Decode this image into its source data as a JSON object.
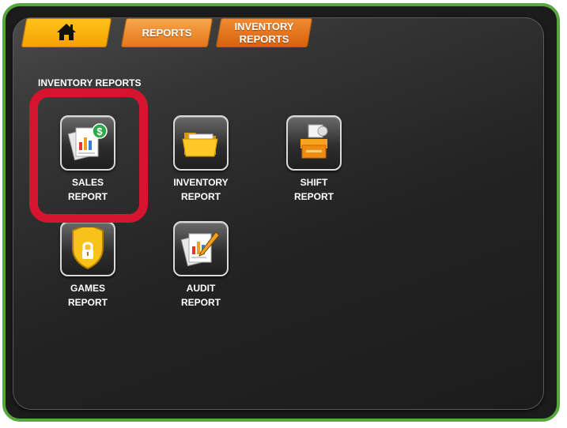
{
  "nav": {
    "home_icon": "home-icon",
    "reports_label": "REPORTS",
    "inventory_reports_line1": "INVENTORY",
    "inventory_reports_line2": "REPORTS"
  },
  "section": {
    "title": "INVENTORY REPORTS"
  },
  "tiles": [
    {
      "line1": "SALES",
      "line2": "REPORT",
      "icon": "sales-report-icon"
    },
    {
      "line1": "INVENTORY",
      "line2": "REPORT",
      "icon": "folder-icon"
    },
    {
      "line1": "SHIFT",
      "line2": "REPORT",
      "icon": "register-icon"
    },
    {
      "line1": "GAMES",
      "line2": "REPORT",
      "icon": "shield-lock-icon"
    },
    {
      "line1": "AUDIT",
      "line2": "REPORT",
      "icon": "audit-report-icon"
    }
  ],
  "colors": {
    "frame_border": "#56a83c",
    "highlight": "#d6142f",
    "tab_home": "#ffc21a",
    "tab_orange": "#e5761c"
  }
}
